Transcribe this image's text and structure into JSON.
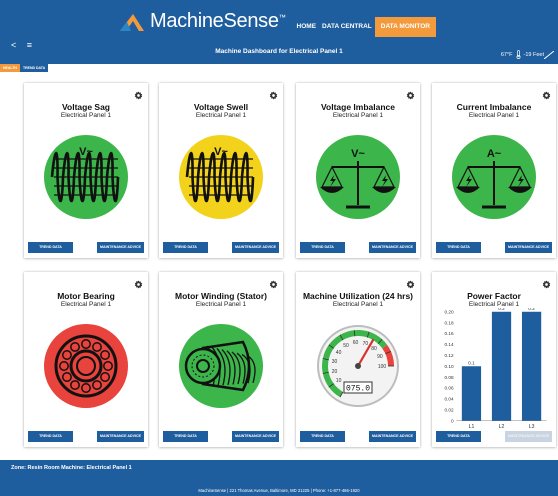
{
  "app": {
    "brand": "MachineSense",
    "brand_tm": "™"
  },
  "topnav": {
    "home": "HOME",
    "data_central": "DATA CENTRAL",
    "data_monitor": "DATA MONITOR",
    "active": "DATA MONITOR"
  },
  "toolbar": {
    "back_icon": "chevron-left-icon",
    "menu_icon": "hamburger-menu-icon"
  },
  "dashboard_title": "Machine Dashboard for Electrical Panel 1",
  "weather": {
    "temp": "67°F",
    "elevation": "-19 Feet",
    "icon": "thermometer-icon"
  },
  "tabs": [
    "HEALTH",
    "TREND DATA"
  ],
  "cards": [
    {
      "title": "Voltage Sag",
      "subtitle": "Electrical Panel 1",
      "status": "good",
      "icon_label": "V~",
      "trend": "TREND DATA",
      "maint": "MAINTENANCE ADVICE"
    },
    {
      "title": "Voltage Swell",
      "subtitle": "Electrical Panel 1",
      "status": "warning",
      "icon_label": "V~",
      "trend": "TREND DATA",
      "maint": "MAINTENANCE ADVICE"
    },
    {
      "title": "Voltage Imbalance",
      "subtitle": "Electrical Panel 1",
      "status": "good",
      "icon_label": "V~",
      "trend": "TREND DATA",
      "maint": "MAINTENANCE ADVICE"
    },
    {
      "title": "Current Imbalance",
      "subtitle": "Electrical Panel 1",
      "status": "good",
      "icon_label": "A~",
      "trend": "TREND DATA",
      "maint": "MAINTENANCE ADVICE"
    },
    {
      "title": "Motor Bearing",
      "subtitle": "Electrical Panel 1",
      "status": "critical",
      "trend": "TREND DATA",
      "maint": "MAINTENANCE ADVICE"
    },
    {
      "title": "Motor Winding (Stator)",
      "subtitle": "Electrical Panel 1",
      "status": "good",
      "trend": "TREND DATA",
      "maint": "MAINTENANCE ADVICE"
    },
    {
      "title": "Machine Utilization (24 hrs)",
      "subtitle": "Electrical Panel 1",
      "gauge_value": "075.0",
      "gauge_ticks": [
        "0",
        "10",
        "20",
        "30",
        "40",
        "50",
        "60",
        "70",
        "80",
        "90",
        "100"
      ],
      "trend": "TREND DATA",
      "maint": "MAINTENANCE ADVICE"
    },
    {
      "title": "Power Factor",
      "subtitle": "Electrical Panel 1",
      "trend": "TREND DATA",
      "maint": "MAINTENANCE ADVICE"
    }
  ],
  "colors": {
    "primary": "#1f5e9e",
    "accent": "#f39a3c",
    "good": "#3cb54a",
    "warning": "#f2d21a",
    "critical": "#e8433c",
    "disabled": "#c9d4e2"
  },
  "gauge": {
    "min": 0,
    "max": 100,
    "value": 75
  },
  "chart_data": {
    "type": "bar",
    "title": "Power Factor",
    "subtitle": "Electrical Panel 1",
    "categories": [
      "L1",
      "L2",
      "L3"
    ],
    "values": [
      0.1,
      0.2,
      0.2
    ],
    "data_labels": [
      "0.1",
      "0.2",
      "0.2"
    ],
    "ylim": [
      0,
      0.2
    ],
    "yticks": [
      "0",
      "0.02",
      "0.04",
      "0.06",
      "0.08",
      "0.10",
      "0.12",
      "0.14",
      "0.16",
      "0.18",
      "0.20"
    ],
    "bar_color": "#1f5e9e"
  },
  "footer": {
    "zone": "Zone: Resin Room Machine: Electrical Panel 1",
    "address": "MachineSense | 221 Thomas Avenue, Baltimore, MD 21225 | Phone: +1-877-466-1920"
  }
}
